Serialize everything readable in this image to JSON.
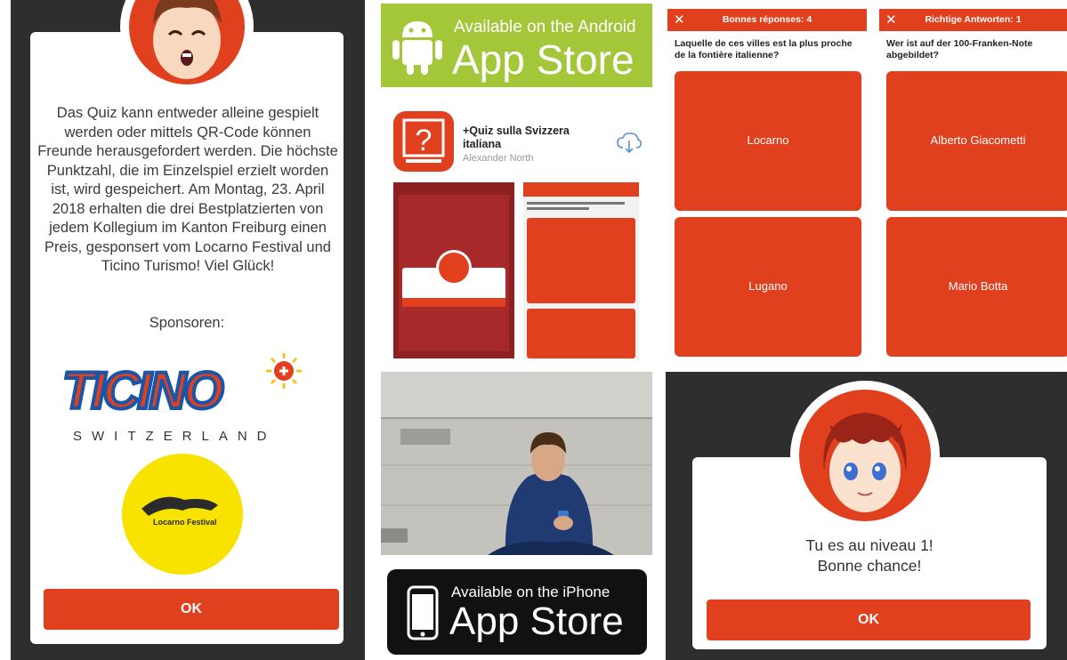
{
  "panel_intro": {
    "description": "Das Quiz kann entweder alleine gespielt werden oder mittels QR-Code können Freunde herausgefordert werden. Die höchste Punktzahl, die im Einzelspiel erzielt worden ist, wird gespeichert. Am Montag, 23. April 2018 erhalten die drei Bestplatzierten von jedem Kollegium im Kanton Freiburg einen Preis, gesponsert vom Locarno Festival und Ticino Turismo! Viel Glück!",
    "sponsors_label": "Sponsoren:",
    "ticino_logo": "TICINO",
    "ticino_sub": "SWITZERLAND",
    "locarno_logo": "Locarno Festival",
    "ok_label": "OK"
  },
  "store": {
    "android_line1": "Available on the Android",
    "android_line2": "App Store",
    "app_icon": "question-mark-icon",
    "app_title": "+Quiz sulla Svizzera italiana",
    "app_author": "Alexander North",
    "iphone_line1": "Available on the iPhone",
    "iphone_line2": "App Store"
  },
  "quiz_fr": {
    "header": "Bonnes réponses: 4",
    "question": "Laquelle de ces villes est la plus proche de la fontière italienne?",
    "answers": [
      "Locarno",
      "Lugano"
    ]
  },
  "quiz_de": {
    "header": "Richtige Antworten: 1",
    "question": "Wer ist auf der 100-Franken-Note abgebildet?",
    "answers": [
      "Alberto Giacometti",
      "Mario Botta"
    ]
  },
  "level_dialog": {
    "line1": "Tu es au niveau 1!",
    "line2": "Bonne chance!",
    "ok_label": "OK"
  },
  "colors": {
    "accent": "#e0401e",
    "dark_bg": "#2e2e2e",
    "android_green": "#a4c639"
  }
}
